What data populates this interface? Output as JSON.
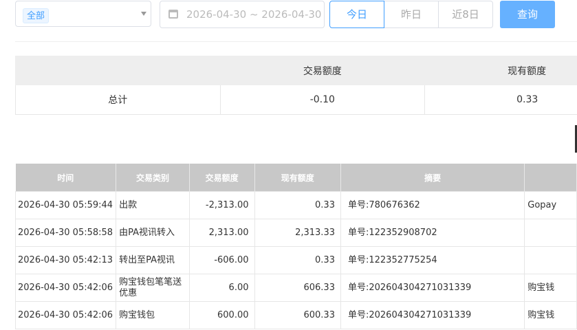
{
  "filter": {
    "category_tag": "全部",
    "date_range": "2026-04-30 ~ 2026-04-30",
    "quick_ranges": [
      "今日",
      "昨日",
      "近8日"
    ],
    "query_label": "查询"
  },
  "summary": {
    "headers": [
      "",
      "交易额度",
      "现有额度"
    ],
    "row": {
      "label": "总计",
      "trade_amount": "-0.10",
      "balance": "0.33"
    }
  },
  "table": {
    "headers": [
      "时间",
      "交易类别",
      "交易额度",
      "现有额度",
      "摘要",
      ""
    ],
    "rows": [
      {
        "time": "2026-04-30 05:59:44",
        "type": "出款",
        "amount": "-2,313.00",
        "balance": "0.33",
        "summary": "单号:780676362",
        "extra": "Gopay"
      },
      {
        "time": "2026-04-30 05:58:58",
        "type": "由PA视讯转入",
        "amount": "2,313.00",
        "balance": "2,313.33",
        "summary": "单号:122352908702",
        "extra": ""
      },
      {
        "time": "2026-04-30 05:42:13",
        "type": "转出至PA视讯",
        "amount": "-606.00",
        "balance": "0.33",
        "summary": "单号:122352775254",
        "extra": ""
      },
      {
        "time": "2026-04-30 05:42:06",
        "type": "购宝钱包笔笔送优惠",
        "amount": "6.00",
        "balance": "606.33",
        "summary": "单号:202604304271031339",
        "extra": "购宝钱"
      },
      {
        "time": "2026-04-30 05:42:06",
        "type": "购宝钱包",
        "amount": "600.00",
        "balance": "600.33",
        "summary": "单号:202604304271031339",
        "extra": "购宝钱"
      }
    ]
  }
}
